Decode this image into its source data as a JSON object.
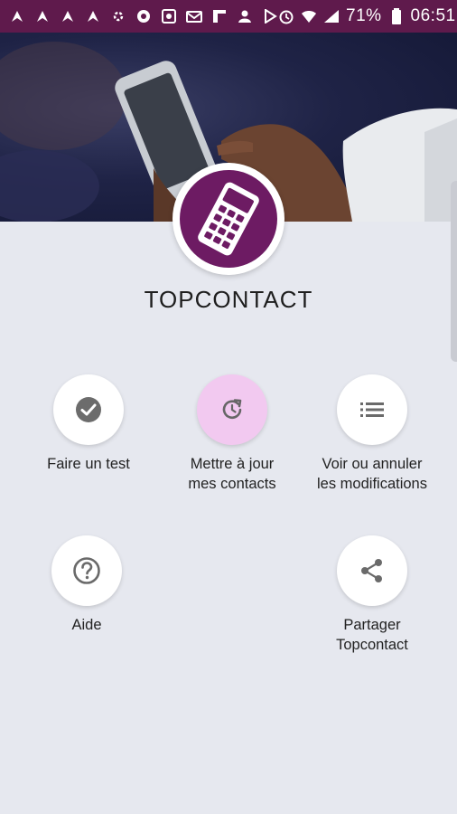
{
  "status_bar": {
    "battery": "71%",
    "time": "06:51",
    "left_icons": [
      "navigation-icon",
      "navigation-icon",
      "navigation-icon",
      "navigation-icon",
      "settings-icon",
      "record-icon",
      "photo-icon",
      "mail-icon",
      "flipboard-icon",
      "contact-icon",
      "play-store-icon"
    ],
    "right_icons": [
      "alarm-icon",
      "wifi-icon",
      "signal-icon",
      "battery-icon"
    ]
  },
  "app": {
    "title": "TOPCONTACT",
    "brand_color": "#6d1b63",
    "status_bar_color": "#5f1a4c"
  },
  "actions": [
    {
      "label": "Faire un test",
      "icon": "check-circle-icon"
    },
    {
      "label": "Mettre à jour\nmes contacts",
      "icon": "update-icon",
      "active": true
    },
    {
      "label": "Voir ou annuler\nles modifications",
      "icon": "list-icon"
    },
    {
      "label": "Aide",
      "icon": "help-icon"
    },
    {
      "label": "Partager\nTopcontact",
      "icon": "share-icon"
    }
  ]
}
